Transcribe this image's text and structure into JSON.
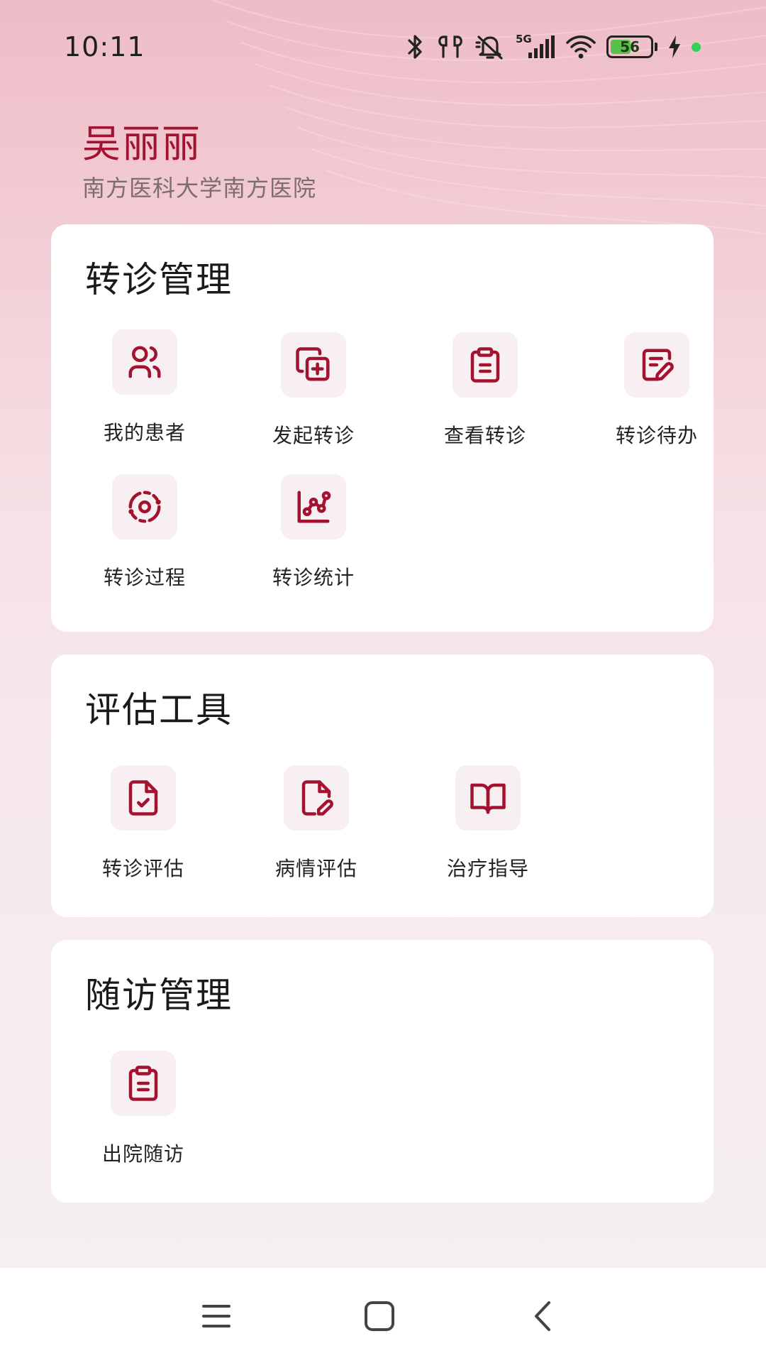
{
  "status_bar": {
    "time": "10:11",
    "network": "5G",
    "battery_level": "56",
    "battery_fraction": 0.56
  },
  "header": {
    "user_name": "吴丽丽",
    "hospital": "南方医科大学南方医院"
  },
  "sections": [
    {
      "title": "转诊管理",
      "items": [
        {
          "label": "我的患者",
          "icon": "patients-icon"
        },
        {
          "label": "发起转诊",
          "icon": "add-copy-icon"
        },
        {
          "label": "查看转诊",
          "icon": "clipboard-icon"
        },
        {
          "label": "转诊待办",
          "icon": "edit-list-icon"
        },
        {
          "label": "转诊过程",
          "icon": "process-icon"
        },
        {
          "label": "转诊统计",
          "icon": "statistics-icon"
        }
      ]
    },
    {
      "title": "评估工具",
      "items": [
        {
          "label": "转诊评估",
          "icon": "file-check-icon"
        },
        {
          "label": "病情评估",
          "icon": "file-edit-icon"
        },
        {
          "label": "治疗指导",
          "icon": "book-icon"
        }
      ]
    },
    {
      "title": "随访管理",
      "items": [
        {
          "label": "出院随访",
          "icon": "clipboard-icon"
        }
      ]
    }
  ],
  "nav": {
    "menu_icon": "menu-icon",
    "home_icon": "home-square-icon",
    "back_icon": "back-chevron-icon"
  },
  "colors": {
    "accent": "#a3122f",
    "icon_bg": "#f7eff1",
    "card": "#ffffff"
  }
}
